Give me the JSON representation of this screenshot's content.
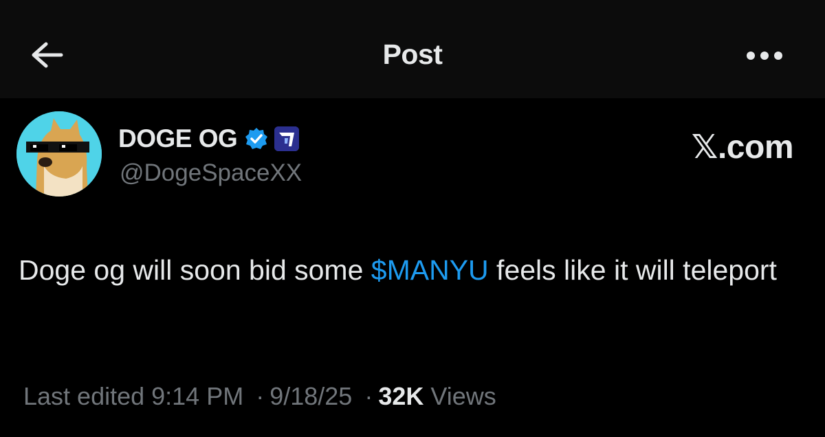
{
  "header": {
    "title": "Post",
    "back_icon": "arrow-left-icon",
    "more_icon": "more-horizontal-icon"
  },
  "author": {
    "display_name": "DOGE OG",
    "handle": "@DogeSpaceXX",
    "verified_icon": "verified-badge-icon",
    "affiliate_icon": "affiliate-badge-icon"
  },
  "watermark": "𝕏.com",
  "post": {
    "text_before": "Doge og will soon bid some ",
    "cashtag": "$MANYU",
    "text_after": " feels like it will teleport"
  },
  "meta": {
    "edited": "Last edited 9:14 PM",
    "separator": "·",
    "date": "9/18/25",
    "views_count": "32K",
    "views_label": "Views"
  },
  "colors": {
    "background": "#000000",
    "header_background": "#0c0c0c",
    "text": "#e7e9ea",
    "secondary_text": "#71767b",
    "link": "#1d9bf0",
    "verified": "#1d9bf0"
  }
}
